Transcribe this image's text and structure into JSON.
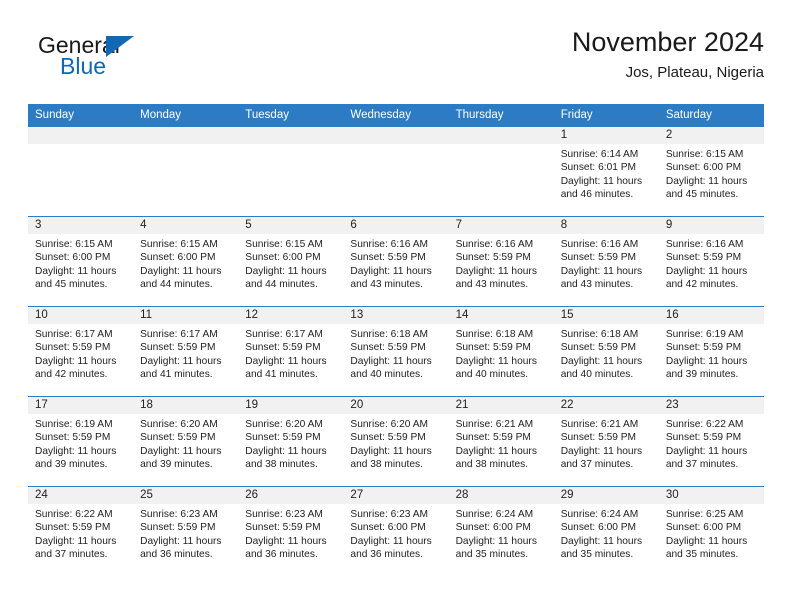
{
  "brand": {
    "name_part1": "General",
    "name_part2": "Blue"
  },
  "header": {
    "title": "November 2024",
    "location": "Jos, Plateau, Nigeria"
  },
  "weekday_headers": [
    "Sunday",
    "Monday",
    "Tuesday",
    "Wednesday",
    "Thursday",
    "Friday",
    "Saturday"
  ],
  "colors": {
    "header_blue": "#2b7cc4",
    "brand_blue": "#1268b3",
    "date_strip_gray": "#f1f1f1",
    "text": "#222222"
  },
  "weeks": [
    [
      {
        "date": "",
        "empty": true
      },
      {
        "date": "",
        "empty": true
      },
      {
        "date": "",
        "empty": true
      },
      {
        "date": "",
        "empty": true
      },
      {
        "date": "",
        "empty": true
      },
      {
        "date": "1",
        "sunrise": "Sunrise: 6:14 AM",
        "sunset": "Sunset: 6:01 PM",
        "daylight": "Daylight: 11 hours and 46 minutes."
      },
      {
        "date": "2",
        "sunrise": "Sunrise: 6:15 AM",
        "sunset": "Sunset: 6:00 PM",
        "daylight": "Daylight: 11 hours and 45 minutes."
      }
    ],
    [
      {
        "date": "3",
        "sunrise": "Sunrise: 6:15 AM",
        "sunset": "Sunset: 6:00 PM",
        "daylight": "Daylight: 11 hours and 45 minutes."
      },
      {
        "date": "4",
        "sunrise": "Sunrise: 6:15 AM",
        "sunset": "Sunset: 6:00 PM",
        "daylight": "Daylight: 11 hours and 44 minutes."
      },
      {
        "date": "5",
        "sunrise": "Sunrise: 6:15 AM",
        "sunset": "Sunset: 6:00 PM",
        "daylight": "Daylight: 11 hours and 44 minutes."
      },
      {
        "date": "6",
        "sunrise": "Sunrise: 6:16 AM",
        "sunset": "Sunset: 5:59 PM",
        "daylight": "Daylight: 11 hours and 43 minutes."
      },
      {
        "date": "7",
        "sunrise": "Sunrise: 6:16 AM",
        "sunset": "Sunset: 5:59 PM",
        "daylight": "Daylight: 11 hours and 43 minutes."
      },
      {
        "date": "8",
        "sunrise": "Sunrise: 6:16 AM",
        "sunset": "Sunset: 5:59 PM",
        "daylight": "Daylight: 11 hours and 43 minutes."
      },
      {
        "date": "9",
        "sunrise": "Sunrise: 6:16 AM",
        "sunset": "Sunset: 5:59 PM",
        "daylight": "Daylight: 11 hours and 42 minutes."
      }
    ],
    [
      {
        "date": "10",
        "sunrise": "Sunrise: 6:17 AM",
        "sunset": "Sunset: 5:59 PM",
        "daylight": "Daylight: 11 hours and 42 minutes."
      },
      {
        "date": "11",
        "sunrise": "Sunrise: 6:17 AM",
        "sunset": "Sunset: 5:59 PM",
        "daylight": "Daylight: 11 hours and 41 minutes."
      },
      {
        "date": "12",
        "sunrise": "Sunrise: 6:17 AM",
        "sunset": "Sunset: 5:59 PM",
        "daylight": "Daylight: 11 hours and 41 minutes."
      },
      {
        "date": "13",
        "sunrise": "Sunrise: 6:18 AM",
        "sunset": "Sunset: 5:59 PM",
        "daylight": "Daylight: 11 hours and 40 minutes."
      },
      {
        "date": "14",
        "sunrise": "Sunrise: 6:18 AM",
        "sunset": "Sunset: 5:59 PM",
        "daylight": "Daylight: 11 hours and 40 minutes."
      },
      {
        "date": "15",
        "sunrise": "Sunrise: 6:18 AM",
        "sunset": "Sunset: 5:59 PM",
        "daylight": "Daylight: 11 hours and 40 minutes."
      },
      {
        "date": "16",
        "sunrise": "Sunrise: 6:19 AM",
        "sunset": "Sunset: 5:59 PM",
        "daylight": "Daylight: 11 hours and 39 minutes."
      }
    ],
    [
      {
        "date": "17",
        "sunrise": "Sunrise: 6:19 AM",
        "sunset": "Sunset: 5:59 PM",
        "daylight": "Daylight: 11 hours and 39 minutes."
      },
      {
        "date": "18",
        "sunrise": "Sunrise: 6:20 AM",
        "sunset": "Sunset: 5:59 PM",
        "daylight": "Daylight: 11 hours and 39 minutes."
      },
      {
        "date": "19",
        "sunrise": "Sunrise: 6:20 AM",
        "sunset": "Sunset: 5:59 PM",
        "daylight": "Daylight: 11 hours and 38 minutes."
      },
      {
        "date": "20",
        "sunrise": "Sunrise: 6:20 AM",
        "sunset": "Sunset: 5:59 PM",
        "daylight": "Daylight: 11 hours and 38 minutes."
      },
      {
        "date": "21",
        "sunrise": "Sunrise: 6:21 AM",
        "sunset": "Sunset: 5:59 PM",
        "daylight": "Daylight: 11 hours and 38 minutes."
      },
      {
        "date": "22",
        "sunrise": "Sunrise: 6:21 AM",
        "sunset": "Sunset: 5:59 PM",
        "daylight": "Daylight: 11 hours and 37 minutes."
      },
      {
        "date": "23",
        "sunrise": "Sunrise: 6:22 AM",
        "sunset": "Sunset: 5:59 PM",
        "daylight": "Daylight: 11 hours and 37 minutes."
      }
    ],
    [
      {
        "date": "24",
        "sunrise": "Sunrise: 6:22 AM",
        "sunset": "Sunset: 5:59 PM",
        "daylight": "Daylight: 11 hours and 37 minutes."
      },
      {
        "date": "25",
        "sunrise": "Sunrise: 6:23 AM",
        "sunset": "Sunset: 5:59 PM",
        "daylight": "Daylight: 11 hours and 36 minutes."
      },
      {
        "date": "26",
        "sunrise": "Sunrise: 6:23 AM",
        "sunset": "Sunset: 5:59 PM",
        "daylight": "Daylight: 11 hours and 36 minutes."
      },
      {
        "date": "27",
        "sunrise": "Sunrise: 6:23 AM",
        "sunset": "Sunset: 6:00 PM",
        "daylight": "Daylight: 11 hours and 36 minutes."
      },
      {
        "date": "28",
        "sunrise": "Sunrise: 6:24 AM",
        "sunset": "Sunset: 6:00 PM",
        "daylight": "Daylight: 11 hours and 35 minutes."
      },
      {
        "date": "29",
        "sunrise": "Sunrise: 6:24 AM",
        "sunset": "Sunset: 6:00 PM",
        "daylight": "Daylight: 11 hours and 35 minutes."
      },
      {
        "date": "30",
        "sunrise": "Sunrise: 6:25 AM",
        "sunset": "Sunset: 6:00 PM",
        "daylight": "Daylight: 11 hours and 35 minutes."
      }
    ]
  ]
}
